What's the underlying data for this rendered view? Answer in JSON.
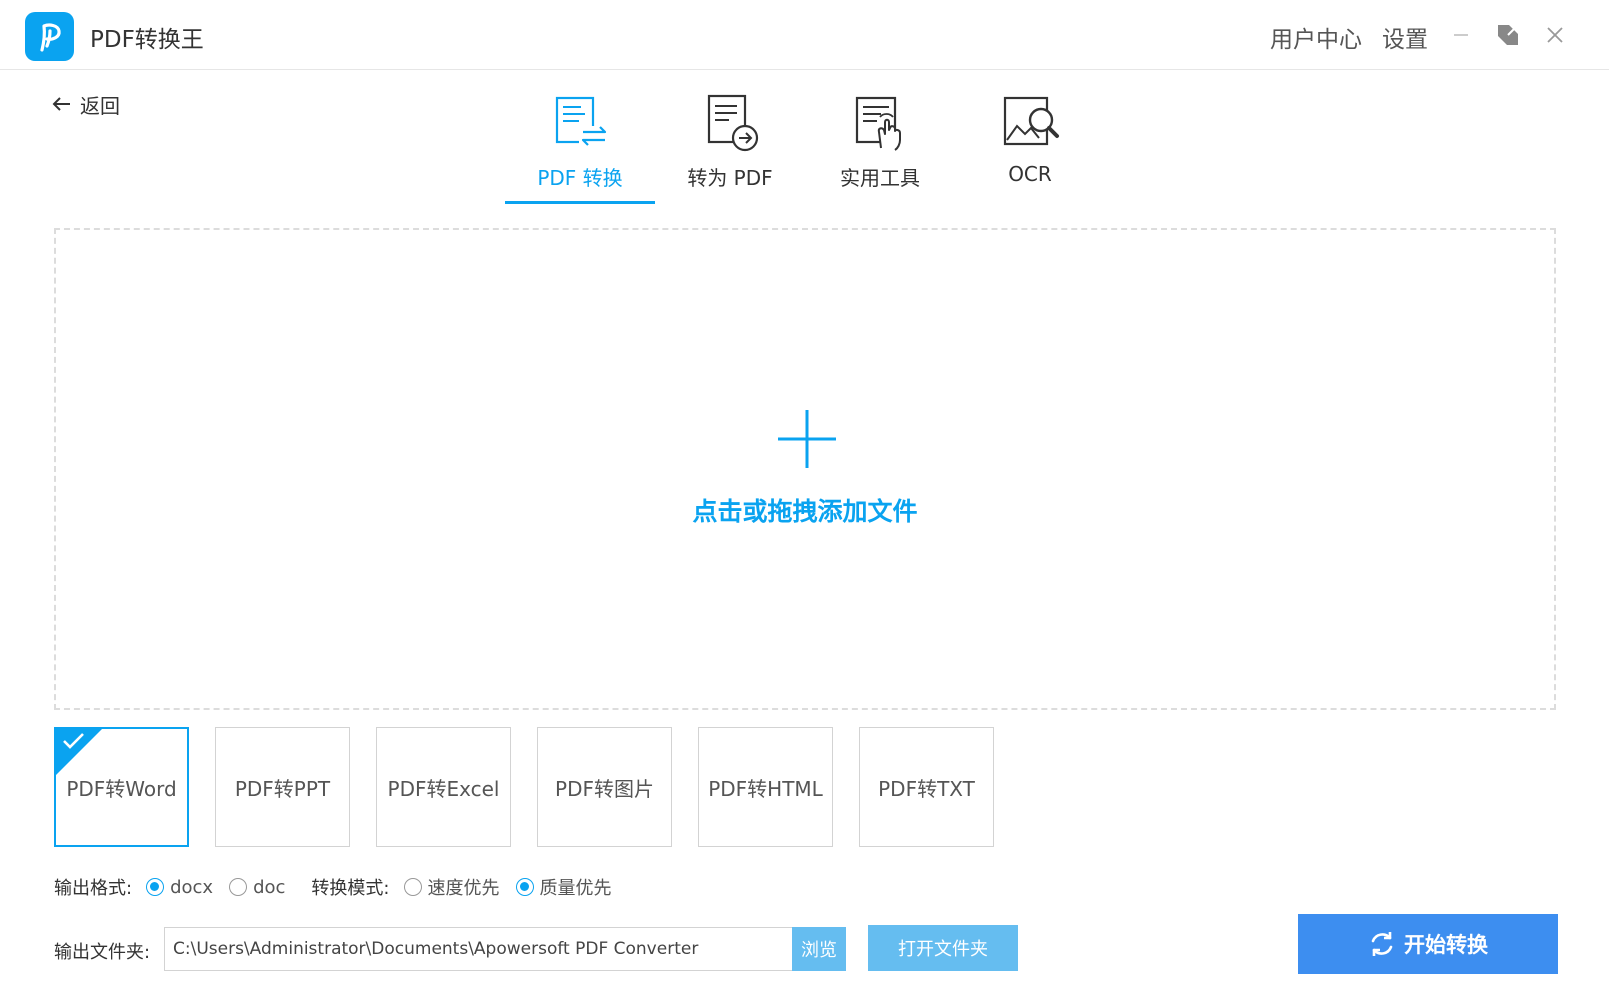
{
  "app": {
    "title": "PDF转换王",
    "logo_icon": "p-logo-icon",
    "accent_color": "#0aa3f0",
    "button_color": "#3d8ef0",
    "secondary_button_color": "#65bdf0"
  },
  "titlebar": {
    "user_center": "用户中心",
    "settings": "设置",
    "minimize_icon": "minimize-icon",
    "restore_icon": "restore-icon",
    "close_icon": "close-icon"
  },
  "nav": {
    "back_label": "返回",
    "tabs": [
      {
        "label": "PDF 转换",
        "icon": "pdf-convert-icon",
        "active": true
      },
      {
        "label": "转为 PDF",
        "icon": "to-pdf-icon",
        "active": false
      },
      {
        "label": "实用工具",
        "icon": "tools-icon",
        "active": false
      },
      {
        "label": "OCR",
        "icon": "ocr-icon",
        "active": false
      }
    ]
  },
  "dropzone": {
    "text": "点击或拖拽添加文件",
    "icon": "plus-icon"
  },
  "conversions": [
    {
      "label": "PDF转Word",
      "selected": true
    },
    {
      "label": "PDF转PPT",
      "selected": false
    },
    {
      "label": "PDF转Excel",
      "selected": false
    },
    {
      "label": "PDF转图片",
      "selected": false
    },
    {
      "label": "PDF转HTML",
      "selected": false
    },
    {
      "label": "PDF转TXT",
      "selected": false
    }
  ],
  "options": {
    "format_label": "输出格式:",
    "format_options": [
      {
        "label": "docx",
        "checked": true
      },
      {
        "label": "doc",
        "checked": false
      }
    ],
    "mode_label": "转换模式:",
    "mode_options": [
      {
        "label": "速度优先",
        "checked": false
      },
      {
        "label": "质量优先",
        "checked": true
      }
    ]
  },
  "output": {
    "folder_label": "输出文件夹:",
    "path": "C:\\Users\\Administrator\\Documents\\Apowersoft PDF Converter",
    "browse_label": "浏览",
    "open_folder_label": "打开文件夹",
    "start_label": "开始转换",
    "start_icon": "refresh-icon"
  }
}
